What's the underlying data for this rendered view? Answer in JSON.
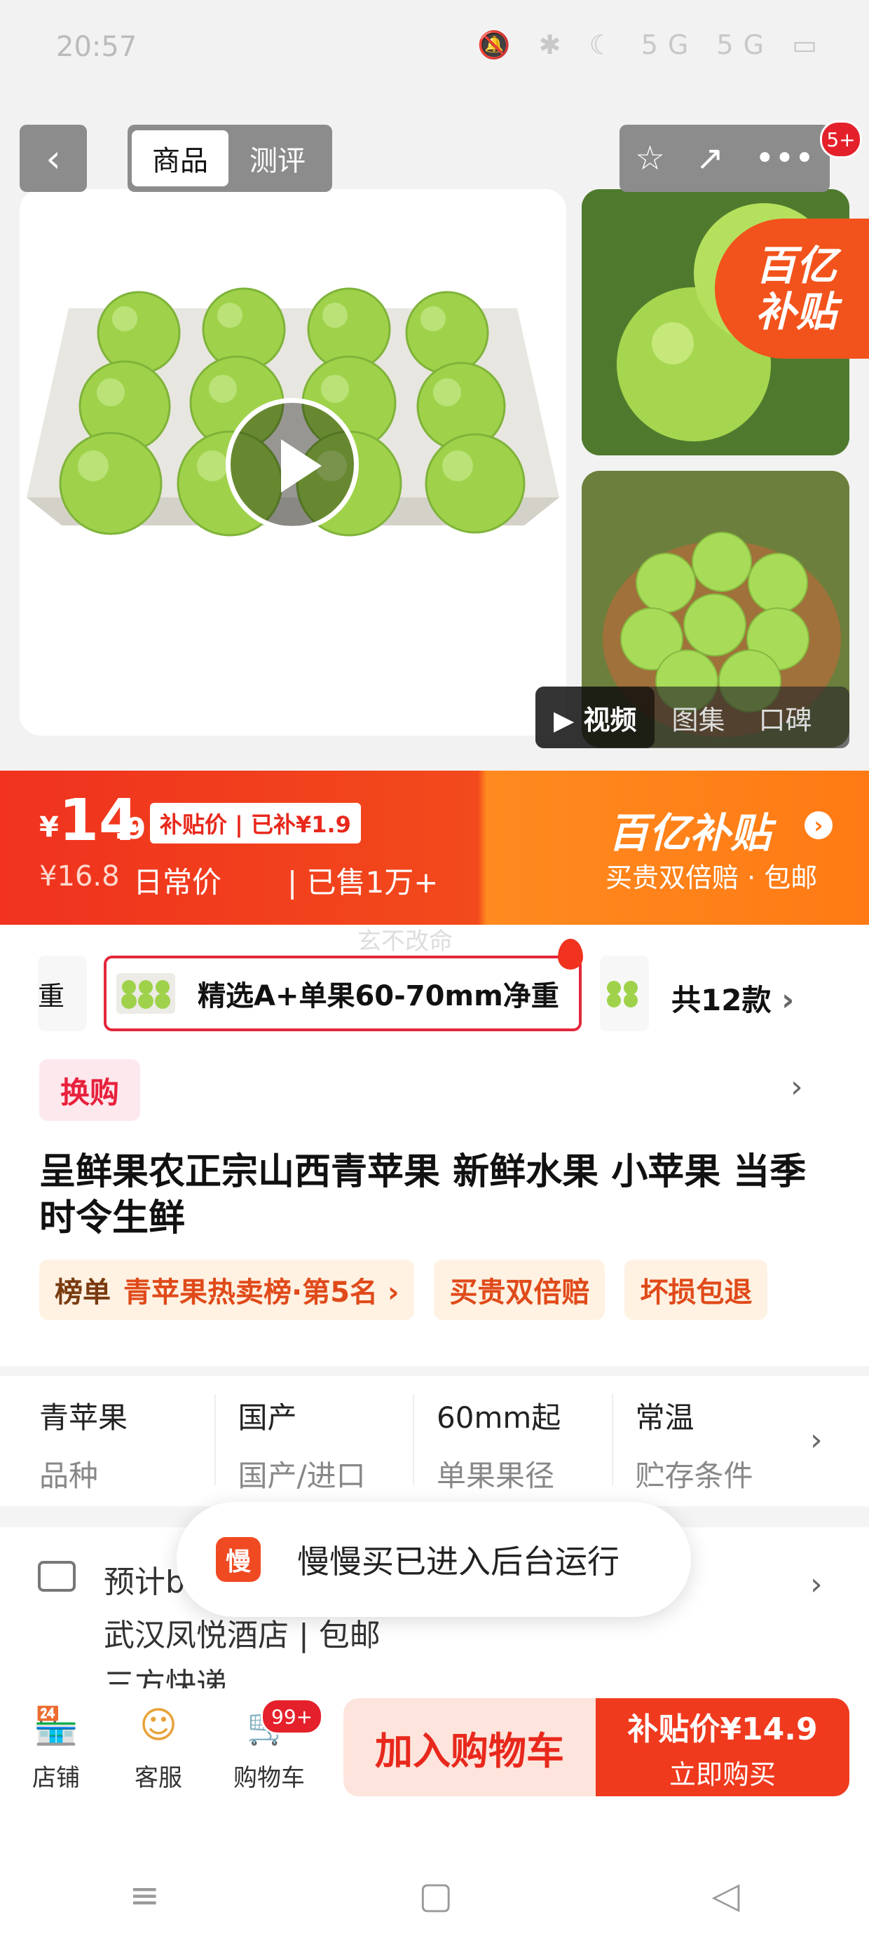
{
  "status_bar": {
    "time": "20:57",
    "icons": "🔕 ✱ ☾ 5G 5G ▭"
  },
  "header": {
    "back_icon": "‹",
    "tab_goods": "商品",
    "tab_review": "测评",
    "fav_icon": "☆",
    "share_icon": "↗",
    "more_icon": "•••",
    "notif_count": "5+"
  },
  "gallery": {
    "badge_line1": "百亿",
    "badge_line2": "补贴",
    "media_tabs": {
      "video": "▶ 视频",
      "images": "图集",
      "word": "口碑"
    }
  },
  "price": {
    "currency": "¥",
    "int": "14",
    "dec": ".9",
    "tag": "补贴价 | 已补¥1.9",
    "original": "¥16.8",
    "daily": "日常价",
    "sold": "| 已售1万+",
    "subsidy_title": "百亿补贴",
    "subsidy_desc": "买贵双倍赔 · 包邮"
  },
  "watermark": "玄不改命",
  "variants": {
    "prev_text": "重",
    "selected": "精选A+单果60-70mm净重",
    "count": "共12款"
  },
  "exchange": "换购",
  "product_title": "呈鲜果农正宗山西青苹果 新鲜水果 小苹果 当季时令生鲜",
  "chips": {
    "rank_label": "榜单",
    "rank_text": "青苹果热卖榜·第5名 ›",
    "c2": "买贵双倍赔",
    "c3": "坏损包退"
  },
  "specs": [
    {
      "value": "青苹果",
      "key": "品种"
    },
    {
      "value": "国产",
      "key": "国产/进口"
    },
    {
      "value": "60mm起",
      "key": "单果果径"
    },
    {
      "value": "常温",
      "key": "贮存条件"
    }
  ],
  "shipping": {
    "line1": "预计b",
    "line2": "武汉凤悦酒店 | 包邮",
    "line3": "三方快递"
  },
  "toast": {
    "logo": "慢",
    "text": "慢慢买已进入后台运行"
  },
  "bottom": {
    "store": "店铺",
    "service": "客服",
    "cart": "购物车",
    "cart_badge": "99+",
    "add_cart": "加入购物车",
    "buy_price": "补贴价¥14.9",
    "buy_now": "立即购买"
  },
  "nav": {
    "menu": "≡",
    "home": "▢",
    "back": "◁"
  }
}
